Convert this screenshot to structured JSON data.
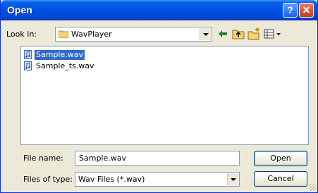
{
  "window": {
    "title": "Open",
    "help_icon": "help-icon",
    "close_icon": "close-icon"
  },
  "lookin": {
    "label": "Look in:",
    "value": "WavPlayer",
    "toolbar_icons": [
      "back-arrow-icon",
      "up-folder-icon",
      "new-folder-icon",
      "views-menu-icon"
    ]
  },
  "files": [
    {
      "name": "Sample.wav",
      "selected": true,
      "icon": "audio-file-icon"
    },
    {
      "name": "Sample_ts.wav",
      "selected": false,
      "icon": "audio-file-icon"
    }
  ],
  "filename": {
    "label": "File name:",
    "value": "Sample.wav"
  },
  "filetype": {
    "label": "Files of type:",
    "value": "Wav Files (*.wav)"
  },
  "buttons": {
    "open": "Open",
    "cancel": "Cancel"
  },
  "colors": {
    "titlebar": "#0054e3",
    "selection": "#316ac5",
    "dialog_bg": "#ece9d8"
  }
}
